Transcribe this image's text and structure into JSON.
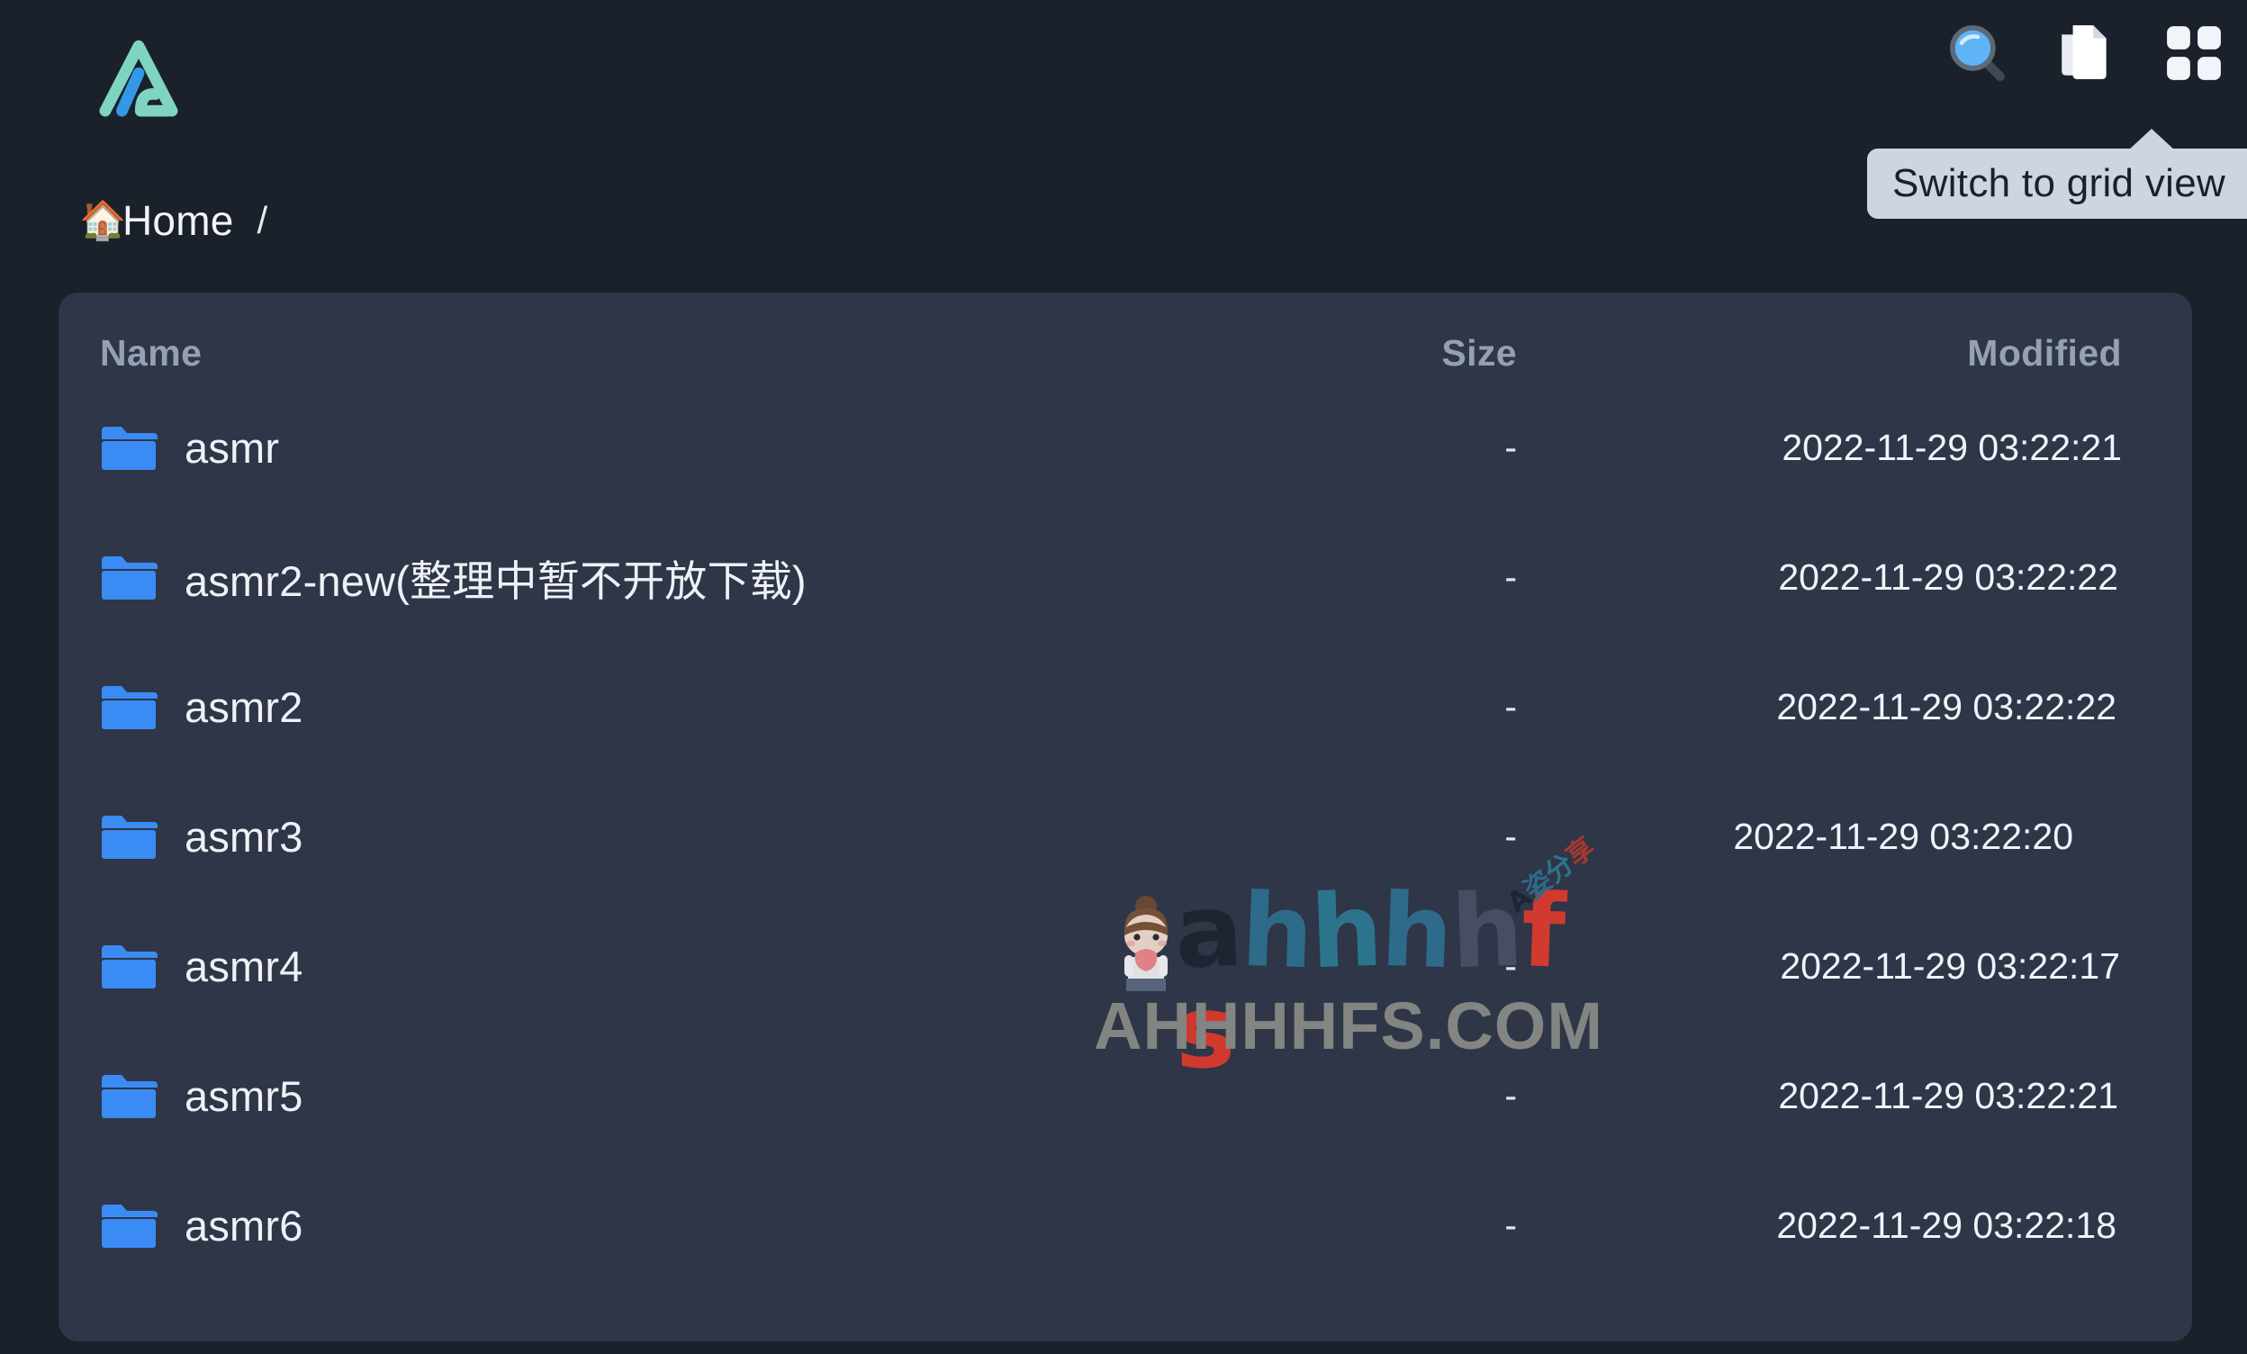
{
  "colors": {
    "page_bg": "#1a212b",
    "panel_bg": "#2e3647",
    "folder_blue": "#3b8bf5",
    "logo_teal": "#7fd4c1",
    "logo_blue": "#3399e6",
    "tooltip_bg": "#ccd5e1",
    "tooltip_text": "#1a202c",
    "header_text": "#95a0b3",
    "row_text": "#eef1f6"
  },
  "toolbar": {
    "search": {
      "label": "Search",
      "icon": "search-icon"
    },
    "copy": {
      "label": "Copy",
      "icon": "copy-icon"
    },
    "grid": {
      "label": "Switch to grid view",
      "icon": "grid-view-icon"
    }
  },
  "tooltip": {
    "text": "Switch to grid view"
  },
  "breadcrumb": {
    "home_icon": "🏠",
    "home_label": "Home",
    "separator": "/"
  },
  "table": {
    "headers": {
      "name": "Name",
      "size": "Size",
      "modified": "Modified"
    },
    "rows": [
      {
        "icon": "folder-icon",
        "name": "asmr",
        "size": "-",
        "modified": "2022-11-29 03:22:21"
      },
      {
        "icon": "folder-icon",
        "name": "asmr2-new(整理中暂不开放下载)",
        "size": "-",
        "modified": "2022-11-29 03:22:22"
      },
      {
        "icon": "folder-icon",
        "name": "asmr2",
        "size": "-",
        "modified": "2022-11-29 03:22:22"
      },
      {
        "icon": "folder-icon",
        "name": "asmr3",
        "size": "-",
        "modified": "2022-11-29 03:22:20"
      },
      {
        "icon": "folder-icon",
        "name": "asmr4",
        "size": "-",
        "modified": "2022-11-29 03:22:17"
      },
      {
        "icon": "folder-icon",
        "name": "asmr5",
        "size": "-",
        "modified": "2022-11-29 03:22:21"
      },
      {
        "icon": "folder-icon",
        "name": "asmr6",
        "size": "-",
        "modified": "2022-11-29 03:22:18"
      }
    ]
  },
  "watermark": {
    "word": "ahhhhfs",
    "subtitle": "AHHHHFS.COM",
    "chinese": "A姿分享",
    "letter_colors": [
      "#1d2430",
      "#2f6f8f",
      "#2c7a92",
      "#2f6f8f",
      "#4a4f66",
      "#e23b2e",
      "#e03a2c"
    ]
  }
}
